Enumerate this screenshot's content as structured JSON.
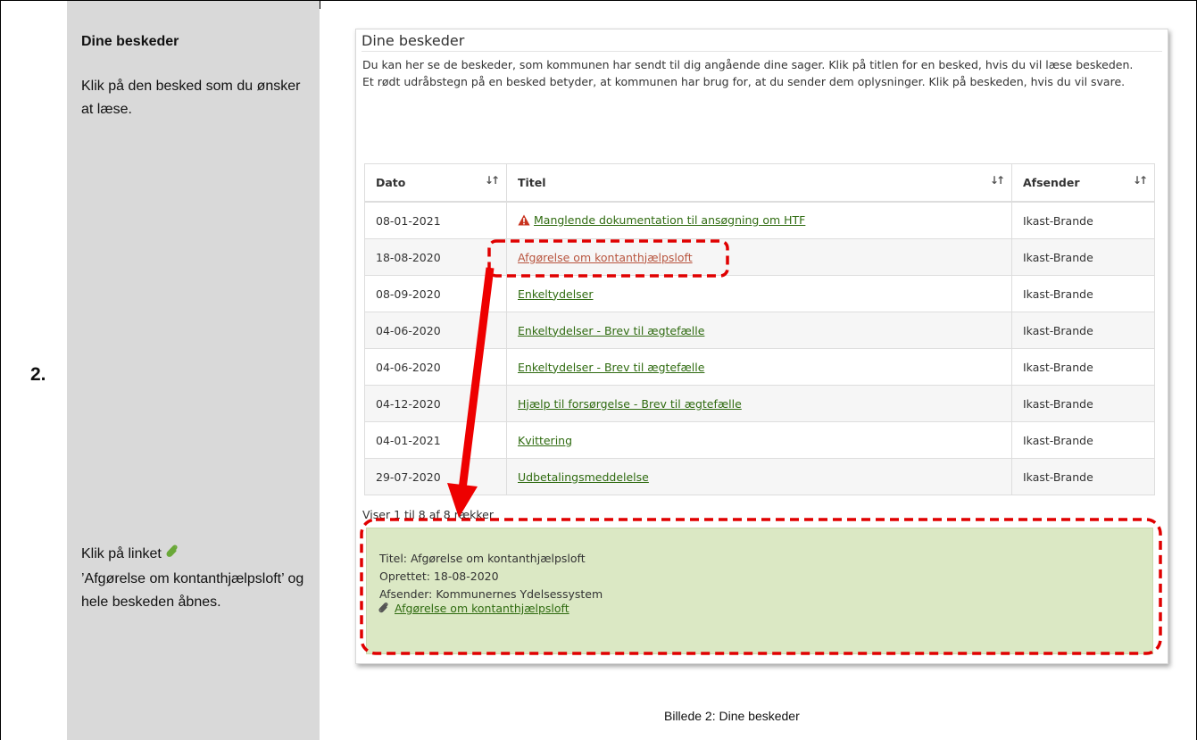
{
  "step": {
    "number": "2."
  },
  "instructions": {
    "title": "Dine beskeder",
    "line1": "Klik på den besked som du ønsker at læse.",
    "line2_prefix": "Klik på linket",
    "line2_rest": "’Afgørelse om kontanthjælpsloft’ og hele beskeden åbnes."
  },
  "screenshot": {
    "title": "Dine beskeder",
    "intro1": "Du kan her se de beskeder, som kommunen har sendt til dig angående dine sager. Klik på titlen for en besked, hvis du vil læse beskeden.",
    "intro2": "Et rødt udråbstegn på en besked betyder, at kommunen har brug for, at du sender dem oplysninger. Klik på beskeden, hvis du vil svare.",
    "columns": {
      "date": "Dato",
      "title": "Titel",
      "sender": "Afsender"
    },
    "rows": [
      {
        "date": "08-01-2021",
        "title": "Manglende dokumentation til ansøgning om HTF",
        "sender": "Ikast-Brande"
      },
      {
        "date": "18-08-2020",
        "title": "Afgørelse om kontanthjælpsloft",
        "sender": "Ikast-Brande"
      },
      {
        "date": "08-09-2020",
        "title": "Enkeltydelser",
        "sender": "Ikast-Brande"
      },
      {
        "date": "04-06-2020",
        "title": "Enkeltydelser - Brev til ægtefælle",
        "sender": "Ikast-Brande"
      },
      {
        "date": "04-06-2020",
        "title": "Enkeltydelser - Brev til ægtefælle",
        "sender": "Ikast-Brande"
      },
      {
        "date": "04-12-2020",
        "title": "Hjælp til forsørgelse - Brev til ægtefælle",
        "sender": "Ikast-Brande"
      },
      {
        "date": "04-01-2021",
        "title": "Kvittering",
        "sender": "Ikast-Brande"
      },
      {
        "date": "29-07-2020",
        "title": "Udbetalingsmeddelelse",
        "sender": "Ikast-Brande"
      }
    ],
    "showing": "Viser 1 til 8 af 8 rækker",
    "detail": {
      "title_line": "Titel: Afgørelse om kontanthjælpsloft",
      "created_line": "Oprettet: 18-08-2020",
      "sender_line": "Afsender: Kommunernes Ydelsessystem",
      "attachment": "Afgørelse om kontanthjælpsloft"
    }
  },
  "caption": "Billede 2: Dine beskeder",
  "colors": {
    "link": "#2f6b10",
    "visited_link": "#b8553f",
    "highlight": "#e00000",
    "detail_bg": "#dbe8c4",
    "instruction_bg": "#d9d9d9"
  },
  "icons": {
    "warning": "warning-triangle-icon",
    "attachment": "paperclip-icon",
    "sort": "sort-arrows-icon"
  }
}
